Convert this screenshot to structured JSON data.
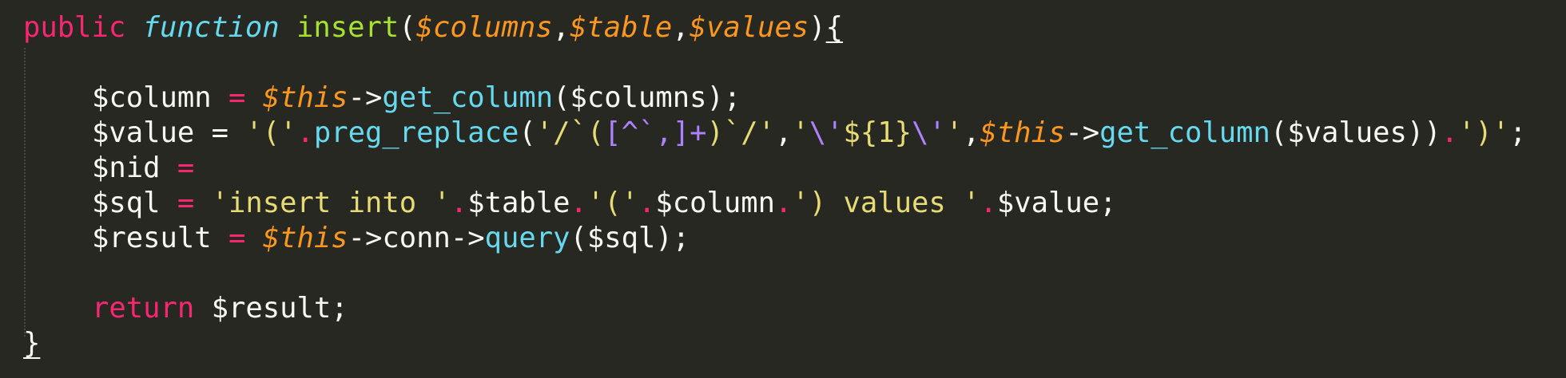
{
  "colors": {
    "background": "#272822",
    "keyword": "#f92672",
    "string": "#e6db74",
    "variable_param": "#fd971f",
    "function_name": "#a6e22e",
    "method_call": "#66d9ef",
    "regex_char": "#ae81ff",
    "plain": "#f8f8f2"
  },
  "code": {
    "l1": {
      "kw_public": "public",
      "kw_function": "function",
      "fn_name": "insert",
      "p_open": "(",
      "param_columns": "$columns",
      "comma1": ",",
      "param_table": "$table",
      "comma2": ",",
      "param_values": "$values",
      "p_close": ")",
      "brace_open": "{"
    },
    "l2": {
      "var": "$column",
      "op": " = ",
      "this": "$this",
      "arrow": "->",
      "method": "get_column",
      "args": "($columns);"
    },
    "l3": {
      "var": "$value",
      "eq": " = ",
      "str1": "'('",
      "dot1": ".",
      "fn": "preg_replace",
      "paren": "(",
      "str2a": "'/`(",
      "rx1": "[^`,]+",
      "str2b": ")`/'",
      "comma": ",",
      "str3a": "'",
      "esc1": "\\'",
      "str3b": "${1}",
      "esc2": "\\'",
      "str3c": "'",
      "comma2": ",",
      "this": "$this",
      "arrow": "->",
      "method": "get_column",
      "args": "($values))",
      "dot2": ".",
      "str4": "')'",
      "semi": ";"
    },
    "l4": {
      "var": "$nid",
      "eq": " ="
    },
    "l5": {
      "var": "$sql",
      "eq": " = ",
      "str1": "'insert into '",
      "dot1": ".",
      "table": "$table",
      "dot2": ".",
      "str2": "'('",
      "dot3": ".",
      "column": "$column",
      "dot4": ".",
      "str3": "') values '",
      "dot5": ".",
      "value": "$value;"
    },
    "l6": {
      "var": "$result",
      "eq": " = ",
      "this": "$this",
      "arrow": "->conn->",
      "method": "query",
      "args": "($sql);"
    },
    "l8": {
      "kw_return": "return",
      "rest": " $result;"
    },
    "l9": {
      "brace_close": "}"
    }
  }
}
